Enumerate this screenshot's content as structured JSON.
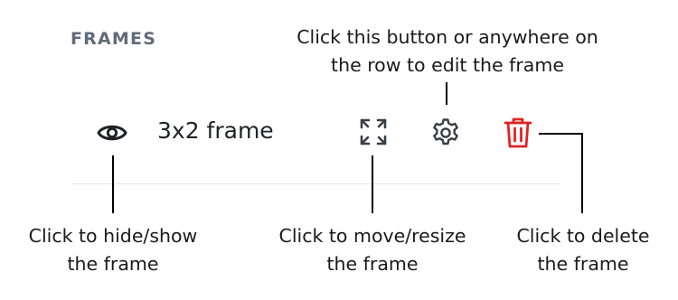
{
  "panel": {
    "title": "FRAMES"
  },
  "frame_row": {
    "name": "3x2 frame",
    "eye_icon": "eye-icon",
    "move_icon": "expand-arrows-icon",
    "settings_icon": "gear-icon",
    "delete_icon": "trash-icon",
    "delete_color": "#e02424"
  },
  "callouts": {
    "edit": [
      "Click this button or anywhere on",
      "the row to edit the frame"
    ],
    "hide": [
      "Click to hide/show",
      "the frame"
    ],
    "move": [
      "Click to move/resize",
      "the frame"
    ],
    "delete": [
      "Click to delete",
      "the frame"
    ]
  }
}
